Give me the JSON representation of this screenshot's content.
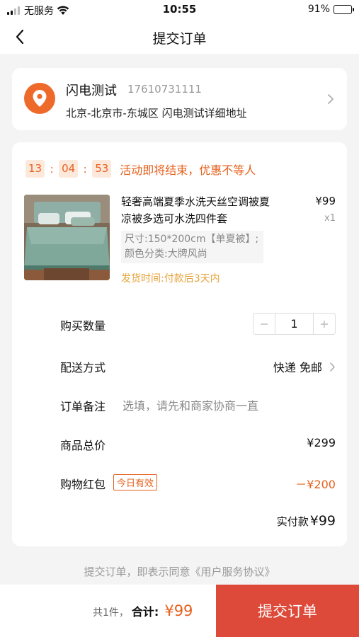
{
  "status_bar": {
    "carrier": "无服务",
    "time": "10:55",
    "battery": "91%",
    "battery_level": 0.91
  },
  "nav": {
    "title": "提交订单"
  },
  "address": {
    "name": "闪电测试",
    "phone": "17610731111",
    "detail": "北京-北京市-东城区 闪电测试详细地址"
  },
  "countdown": {
    "hours": "13",
    "minutes": "04",
    "seconds": "53",
    "message": "活动即将结束，优惠不等人"
  },
  "product": {
    "title": "轻奢高端夏季水洗天丝空调被夏凉被多选可水洗四件套",
    "price": "¥99",
    "quantity": "x1",
    "spec": "尺寸:150*200cm【单夏被】;颜色分类:大牌风尚",
    "ship_time": "发货时间:付款后3天内"
  },
  "rows": {
    "quantity_label": "购买数量",
    "quantity_value": "1",
    "delivery_label": "配送方式",
    "delivery_value": "快递 免邮",
    "remark_label": "订单备注",
    "remark_placeholder": "选填，请先和商家协商一直",
    "subtotal_label": "商品总价",
    "subtotal_value": "¥299",
    "coupon_label": "购物红包",
    "coupon_tag": "今日有效",
    "coupon_value": "－¥200",
    "paid_label": "实付款",
    "paid_value": "¥99"
  },
  "agreement": "提交订单，即表示同意《用户服务协议》",
  "bottom": {
    "count": "共1件，",
    "total_label": "合计:",
    "total_value": "¥99",
    "submit_label": "提交订单"
  },
  "colors": {
    "accent": "#e6601c",
    "submit": "#dd4a3a",
    "ship_time": "#e5a23a",
    "location_icon": "#ee6a2a"
  }
}
